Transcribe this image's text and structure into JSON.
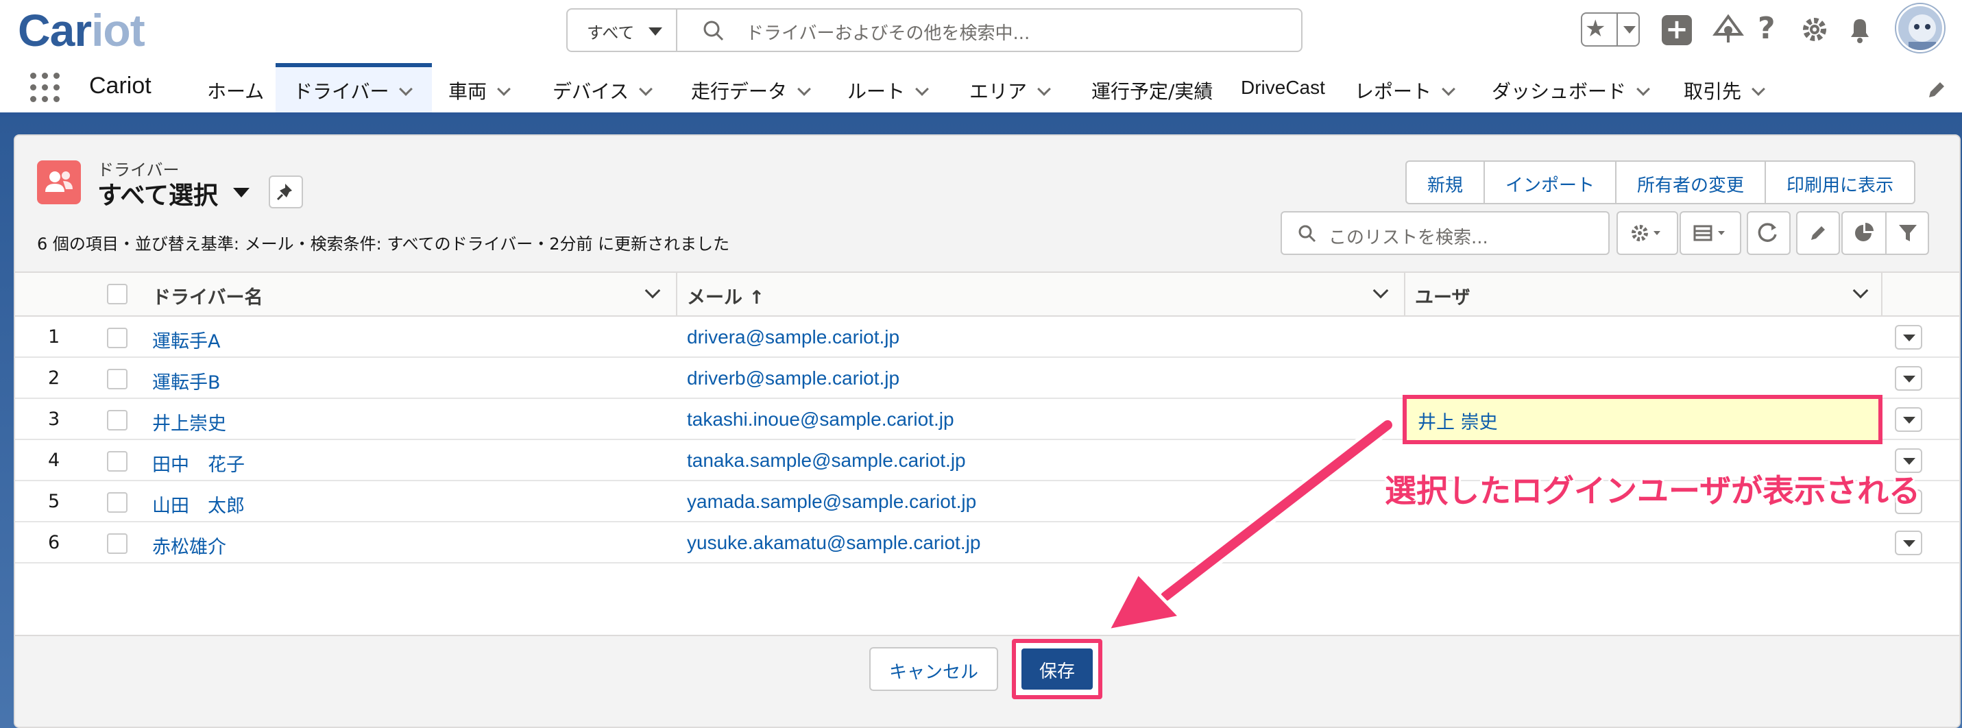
{
  "header": {
    "logo_main": "Car",
    "logo_light": "iot",
    "search_scope": "すべて",
    "search_placeholder": "ドライバーおよびその他を検索中..."
  },
  "nav": {
    "app_name": "Cariot",
    "items": [
      {
        "label": "ホーム",
        "has_menu": false
      },
      {
        "label": "ドライバー",
        "has_menu": true,
        "active": true
      },
      {
        "label": "車両",
        "has_menu": true
      },
      {
        "label": "デバイス",
        "has_menu": true
      },
      {
        "label": "走行データ",
        "has_menu": true
      },
      {
        "label": "ルート",
        "has_menu": true
      },
      {
        "label": "エリア",
        "has_menu": true
      },
      {
        "label": "運行予定/実績",
        "has_menu": false
      },
      {
        "label": "DriveCast",
        "has_menu": false
      },
      {
        "label": "レポート",
        "has_menu": true
      },
      {
        "label": "ダッシュボード",
        "has_menu": true
      },
      {
        "label": "取引先",
        "has_menu": true
      }
    ]
  },
  "list": {
    "object_type": "ドライバー",
    "view_name": "すべて選択",
    "info": "6 個の項目・並び替え基準: メール・検索条件: すべてのドライバー・2分前 に更新されました",
    "actions": [
      "新規",
      "インポート",
      "所有者の変更",
      "印刷用に表示"
    ],
    "search_placeholder": "このリストを検索..."
  },
  "table": {
    "columns": [
      "ドライバー名",
      "メール ↑",
      "ユーザ"
    ],
    "rows": [
      {
        "num": "1",
        "name": "運転手A",
        "email": "drivera@sample.cariot.jp",
        "user": ""
      },
      {
        "num": "2",
        "name": "運転手B",
        "email": "driverb@sample.cariot.jp",
        "user": ""
      },
      {
        "num": "3",
        "name": "井上崇史",
        "email": "takashi.inoue@sample.cariot.jp",
        "user": "井上 崇史"
      },
      {
        "num": "4",
        "name": "田中　花子",
        "email": "tanaka.sample@sample.cariot.jp",
        "user": ""
      },
      {
        "num": "5",
        "name": "山田　太郎",
        "email": "yamada.sample@sample.cariot.jp",
        "user": ""
      },
      {
        "num": "6",
        "name": "赤松雄介",
        "email": "yusuke.akamatu@sample.cariot.jp",
        "user": ""
      }
    ]
  },
  "annotation": {
    "text": "選択したログインユーザが表示される",
    "color": "#f2386e"
  },
  "footer": {
    "cancel_label": "キャンセル",
    "save_label": "保存"
  }
}
